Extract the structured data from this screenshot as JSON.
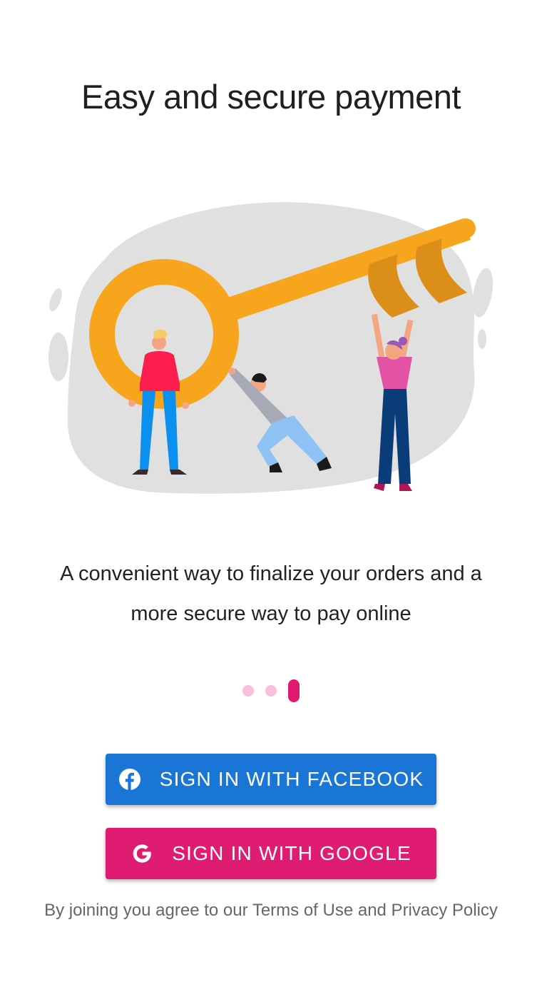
{
  "page": {
    "title": "Easy and secure payment",
    "description_line1": "A convenient way to finalize your orders and a",
    "description_line2": "more secure way to pay online",
    "illustration": "people-lifting-golden-key-illustration"
  },
  "pager": {
    "total": 3,
    "active_index": 2
  },
  "buttons": {
    "facebook_label": "SIGN IN WITH FACEBOOK",
    "facebook_icon": "facebook-icon",
    "google_label": "SIGN IN WITH GOOGLE",
    "google_icon": "google-icon"
  },
  "footer": {
    "terms_text": "By joining you agree to our Terms of Use and Privacy Policy"
  },
  "colors": {
    "facebook_blue": "#1976d6",
    "google_pink": "#e01b72",
    "dot_inactive": "#f7bfd9",
    "dot_active": "#e0196f",
    "key_gold": "#f8a51e"
  }
}
